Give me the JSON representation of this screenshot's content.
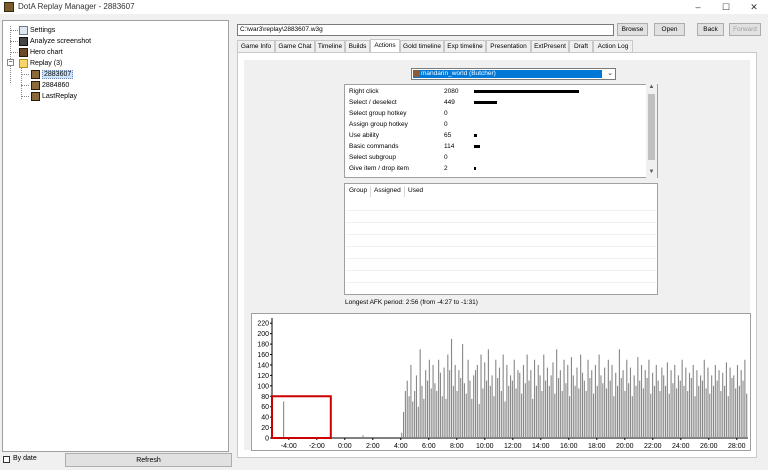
{
  "window": {
    "title": "DotA Replay Manager - 2883607",
    "controls": {
      "minimize": "–",
      "maximize": "☐",
      "close": "✕"
    }
  },
  "tree": {
    "items": [
      {
        "label": "Settings",
        "icon": "settings-icon"
      },
      {
        "label": "Analyze screenshot",
        "icon": "camera-icon"
      },
      {
        "label": "Hero chart",
        "icon": "hero-icon"
      },
      {
        "label": "Replay (3)",
        "icon": "folder-icon",
        "expander": "−"
      },
      {
        "label": "2883607",
        "icon": "replay-icon",
        "selected": true
      },
      {
        "label": "2884860",
        "icon": "replay-icon"
      },
      {
        "label": "LastReplay",
        "icon": "replay-icon"
      }
    ]
  },
  "bottom": {
    "by_date_label": "By date",
    "refresh_label": "Refresh"
  },
  "path": {
    "value": "C:\\war3\\replay\\2883607.w3g",
    "browse": "Browse",
    "open": "Open",
    "back": "Back",
    "forward": "Forward"
  },
  "tabs": [
    {
      "label": "Game Info"
    },
    {
      "label": "Game Chat"
    },
    {
      "label": "Timeline"
    },
    {
      "label": "Builds"
    },
    {
      "label": "Actions",
      "active": true
    },
    {
      "label": "Gold timeline"
    },
    {
      "label": "Exp timeline"
    },
    {
      "label": "Presentation"
    },
    {
      "label": "ExtPresent"
    },
    {
      "label": "Draft"
    },
    {
      "label": "Action Log"
    }
  ],
  "player_select": {
    "value": "mandarin_world (Butcher)",
    "chevron": "⌄"
  },
  "actions": [
    {
      "name": "Right click",
      "count": 2080
    },
    {
      "name": "Select / deselect",
      "count": 449
    },
    {
      "name": "Select group hotkey",
      "count": 0
    },
    {
      "name": "Assign group hotkey",
      "count": 0
    },
    {
      "name": "Use ability",
      "count": 65
    },
    {
      "name": "Basic commands",
      "count": 114
    },
    {
      "name": "Select subgroup",
      "count": 0
    },
    {
      "name": "Give item / drop item",
      "count": 2
    }
  ],
  "scroll": {
    "up": "▲",
    "down": "▼"
  },
  "group_table": {
    "headers": [
      "Group",
      "Assigned",
      "Used"
    ]
  },
  "afk": "Longest AFK period: 2:56 (from -4:27 to -1:31)",
  "chart_data": {
    "type": "bar",
    "yticks": [
      "0",
      "20",
      "40",
      "60",
      "80",
      "100",
      "120",
      "140",
      "160",
      "180",
      "200",
      "220"
    ],
    "ylim": [
      0,
      230
    ],
    "xticks": [
      "-4:00",
      "-2:00",
      "0:00",
      "2:00",
      "4:00",
      "6:00",
      "8:00",
      "10:00",
      "12:00",
      "14:00",
      "16:00",
      "18:00",
      "20:00",
      "22:00",
      "24:00",
      "26:00",
      "28:00"
    ],
    "xlim_minutes": [
      -5.2,
      28.8
    ],
    "highlight_minutes": [
      -5.2,
      -1.0
    ],
    "highlight_color": "#cc0000",
    "bar_color": "#888888",
    "series": [
      {
        "values": [
          0,
          0,
          0,
          0,
          0,
          0,
          70,
          0,
          0,
          0,
          0,
          0,
          0,
          0,
          0,
          0,
          0,
          0,
          0,
          0,
          0,
          0,
          0,
          0,
          0,
          0,
          0,
          0,
          0,
          0,
          0,
          0,
          0,
          0,
          0,
          0,
          0,
          0,
          0,
          0,
          0,
          0,
          0,
          0,
          0,
          0,
          0,
          0,
          0,
          5,
          0,
          0,
          0,
          0,
          0,
          0,
          0,
          0,
          0,
          0,
          0,
          0,
          0,
          0,
          0,
          0,
          0,
          0,
          0,
          0,
          10,
          50,
          90,
          110,
          80,
          140,
          70,
          90,
          120,
          60,
          170,
          100,
          75,
          130,
          110,
          150,
          95,
          140,
          105,
          90,
          150,
          125,
          80,
          135,
          75,
          160,
          130,
          190,
          100,
          140,
          90,
          130,
          115,
          180,
          105,
          85,
          150,
          110,
          75,
          120,
          130,
          140,
          65,
          160,
          95,
          145,
          110,
          170,
          100,
          120,
          80,
          150,
          115,
          135,
          90,
          160,
          70,
          140,
          100,
          120,
          110,
          150,
          95,
          130,
          125,
          85,
          140,
          105,
          160,
          110,
          130,
          75,
          150,
          100,
          140,
          120,
          90,
          160,
          110,
          135,
          100,
          120,
          145,
          85,
          170,
          115,
          130,
          90,
          150,
          105,
          140,
          80,
          155,
          120,
          100,
          135,
          95,
          160,
          125,
          110,
          90,
          150,
          115,
          130,
          85,
          140,
          100,
          160,
          120,
          105,
          135,
          95,
          150,
          110,
          140,
          80,
          125,
          100,
          170,
          115,
          130,
          90,
          150,
          105,
          135,
          80,
          120,
          100,
          155,
          110,
          140,
          95,
          130,
          115,
          150,
          85,
          125,
          100,
          140,
          110,
          90,
          135,
          120,
          100,
          145,
          85,
          130,
          105,
          140,
          95,
          120,
          110,
          150,
          100,
          135,
          90,
          125,
          115,
          140,
          80,
          130,
          100,
          120,
          110,
          150,
          95,
          135,
          85,
          120,
          100,
          140,
          110,
          130,
          90,
          125,
          100,
          145,
          80,
          135,
          115,
          120,
          95,
          140,
          100,
          130,
          110,
          150,
          85
        ]
      }
    ]
  }
}
